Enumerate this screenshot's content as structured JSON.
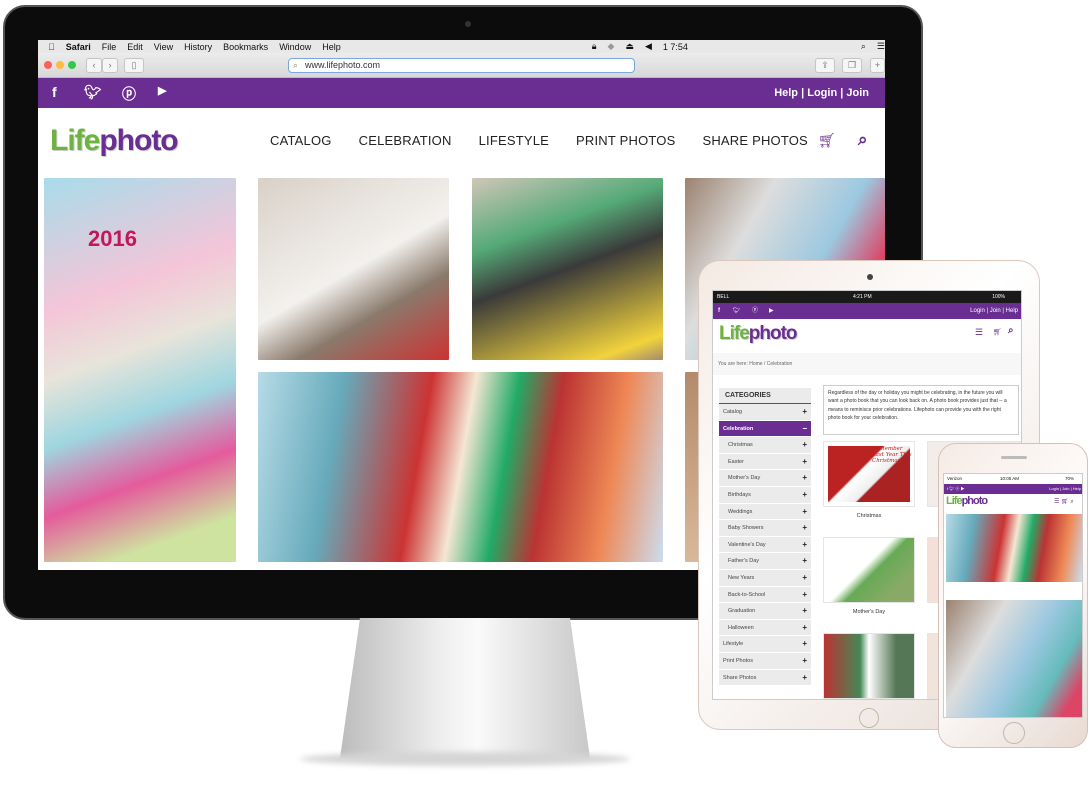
{
  "desktop": {
    "menubar": {
      "app": "Safari",
      "items": [
        "File",
        "Edit",
        "View",
        "History",
        "Bookmarks",
        "Window",
        "Help"
      ],
      "clock": "Thu Dec 1  7:54 PM"
    },
    "url": "www.lifephoto.com",
    "social_icons": [
      "facebook-icon",
      "twitter-icon",
      "pinterest-icon",
      "youtube-icon"
    ],
    "top_links": [
      "Help",
      "Login",
      "Join"
    ],
    "logo": {
      "part1": "Life",
      "part2": "photo"
    },
    "nav": [
      "CATALOG",
      "CELEBRATION",
      "LIFESTYLE",
      "PRINT PHOTOS",
      "SHARE PHOTOS"
    ],
    "photos": {
      "calendar_year": "2016"
    },
    "colors": {
      "brand_purple": "#6a2d91",
      "brand_green": "#6db33f"
    }
  },
  "tablet": {
    "status": {
      "carrier": "BELL",
      "time": "4:21 PM",
      "battery": "100%"
    },
    "top_links": [
      "Login",
      "Join",
      "Help"
    ],
    "breadcrumb": {
      "prefix": "You are here:",
      "home": "Home",
      "current": "Celebration"
    },
    "categories_title": "CATEGORIES",
    "categories": [
      {
        "label": "Catalog",
        "sign": "+",
        "level": 0
      },
      {
        "label": "Celebration",
        "sign": "−",
        "level": 0,
        "active": true
      },
      {
        "label": "Christmas",
        "sign": "+",
        "level": 1
      },
      {
        "label": "Easter",
        "sign": "+",
        "level": 1
      },
      {
        "label": "Mother's Day",
        "sign": "+",
        "level": 1
      },
      {
        "label": "Birthdays",
        "sign": "+",
        "level": 1
      },
      {
        "label": "Weddings",
        "sign": "+",
        "level": 1
      },
      {
        "label": "Baby Showers",
        "sign": "+",
        "level": 1
      },
      {
        "label": "Valentine's Day",
        "sign": "+",
        "level": 1
      },
      {
        "label": "Father's Day",
        "sign": "+",
        "level": 1
      },
      {
        "label": "New Years",
        "sign": "+",
        "level": 1
      },
      {
        "label": "Back-to-School",
        "sign": "+",
        "level": 1
      },
      {
        "label": "Graduation",
        "sign": "+",
        "level": 1
      },
      {
        "label": "Halloween",
        "sign": "+",
        "level": 1
      },
      {
        "label": "Lifestyle",
        "sign": "+",
        "level": 0
      },
      {
        "label": "Print Photos",
        "sign": "+",
        "level": 0
      },
      {
        "label": "Share Photos",
        "sign": "+",
        "level": 0
      }
    ],
    "description": "Regardless of the day or holiday you might be celebrating, in the future you will want a photo book that you can look back on. A photo book provides just that -- a means to reminisce prior celebrations. Lifephoto can provide you with the right photo book for your celebration.",
    "products": [
      {
        "label": "Christmas",
        "art_text": "Remember Last Year This Christmas"
      },
      {
        "label": "Mother's Day"
      }
    ]
  },
  "phone": {
    "status": {
      "carrier": "Verizon",
      "time": "10:05 AM",
      "battery": "70%"
    },
    "top_links": "Login | Join | Help"
  }
}
